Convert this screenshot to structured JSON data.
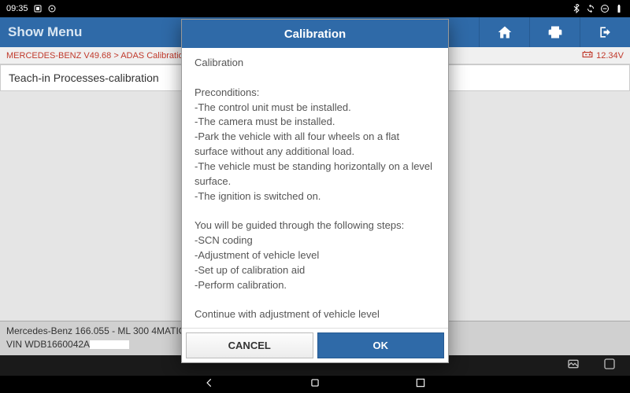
{
  "statusbar": {
    "time": "09:35"
  },
  "header": {
    "title": "Show Menu"
  },
  "breadcrumb": {
    "path": "MERCEDES-BENZ V49.68 > ADAS Calibration",
    "voltage": "12.34V"
  },
  "section": {
    "title": "Teach-in Processes-calibration"
  },
  "footer": {
    "line1": "Mercedes-Benz 166.055 - ML 300 4MATIC",
    "line2_prefix": "VIN WDB1660042A"
  },
  "dialog": {
    "title": "Calibration",
    "body": "Calibration\n\nPreconditions:\n-The control unit must be installed.\n-The camera must be installed.\n-Park the vehicle with all four wheels on a flat surface without any additional load.\n-The vehicle must be standing horizontally on a level surface.\n-The ignition is switched on.\n\nYou will be guided through the following steps:\n-SCN coding\n-Adjustment of vehicle level\n-Set up of calibration aid\n-Perform calibration.\n\nContinue with adjustment of vehicle level",
    "cancel": "CANCEL",
    "ok": "OK"
  }
}
